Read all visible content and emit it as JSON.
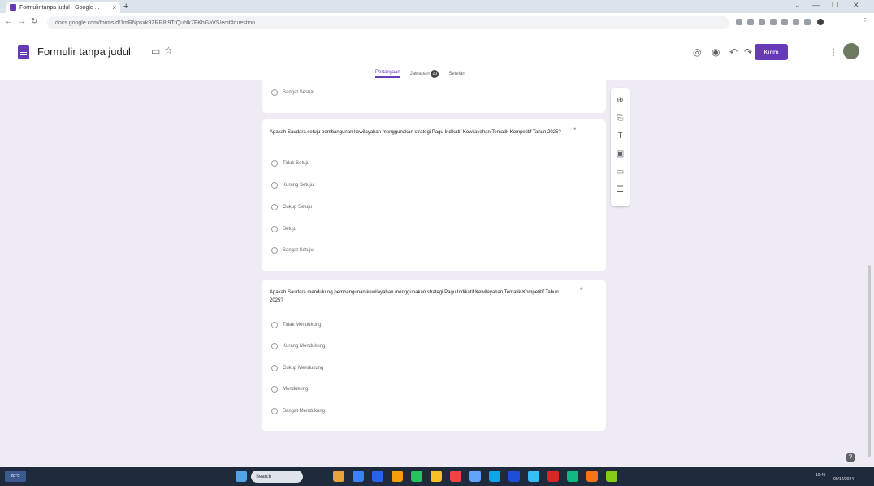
{
  "browser": {
    "tab_title": "Formulir tanpa judul - Google ...",
    "tab_close": "×",
    "new_tab": "+",
    "url": "docs.google.com/forms/d/1mRNpsxk9ZRR8t9TrQuhlk7FKhGaVS/edit#question",
    "window_controls": [
      "⌄",
      "—",
      "❐",
      "✕"
    ]
  },
  "form_header": {
    "title": "Formulir tanpa judul",
    "send_label": "Kirim",
    "tabs": [
      {
        "label": "Pertanyaan"
      },
      {
        "label": "Jawaban"
      },
      {
        "label": "Setelan"
      }
    ],
    "responses_badge": "20"
  },
  "cards": [
    {
      "options": [
        {
          "label": "Sangat Sesuai"
        }
      ]
    },
    {
      "question": "Apakah Saudara setuju pembangunan kewilayahan menggunakan strategi Pagu Indikatif Kewilayahan Tematik Kompetitif Tahun 2025?",
      "options": [
        {
          "label": "Tidak Setuju"
        },
        {
          "label": "Kurang Setuju"
        },
        {
          "label": "Cukup Setuju"
        },
        {
          "label": "Setuju"
        },
        {
          "label": "Sangat Setuju"
        }
      ]
    },
    {
      "question": "Apakah Saudara mendukung pembangunan kewilayahan menggunakan strategi Pagu Indikatif Kewilayahan Tematik Kompetitif Tahun 2025?",
      "options": [
        {
          "label": "Tidak Mendukung"
        },
        {
          "label": "Kurang Mendukung"
        },
        {
          "label": "Cukup Mendukung"
        },
        {
          "label": "Mendukung"
        },
        {
          "label": "Sangat Mendukung"
        }
      ]
    }
  ],
  "taskbar": {
    "weather": "28°C",
    "search_placeholder": "Search",
    "time": "10:45",
    "date": "09/12/2024"
  },
  "colors": {
    "accent": "#673ab7",
    "page_bg": "#efebf5"
  }
}
